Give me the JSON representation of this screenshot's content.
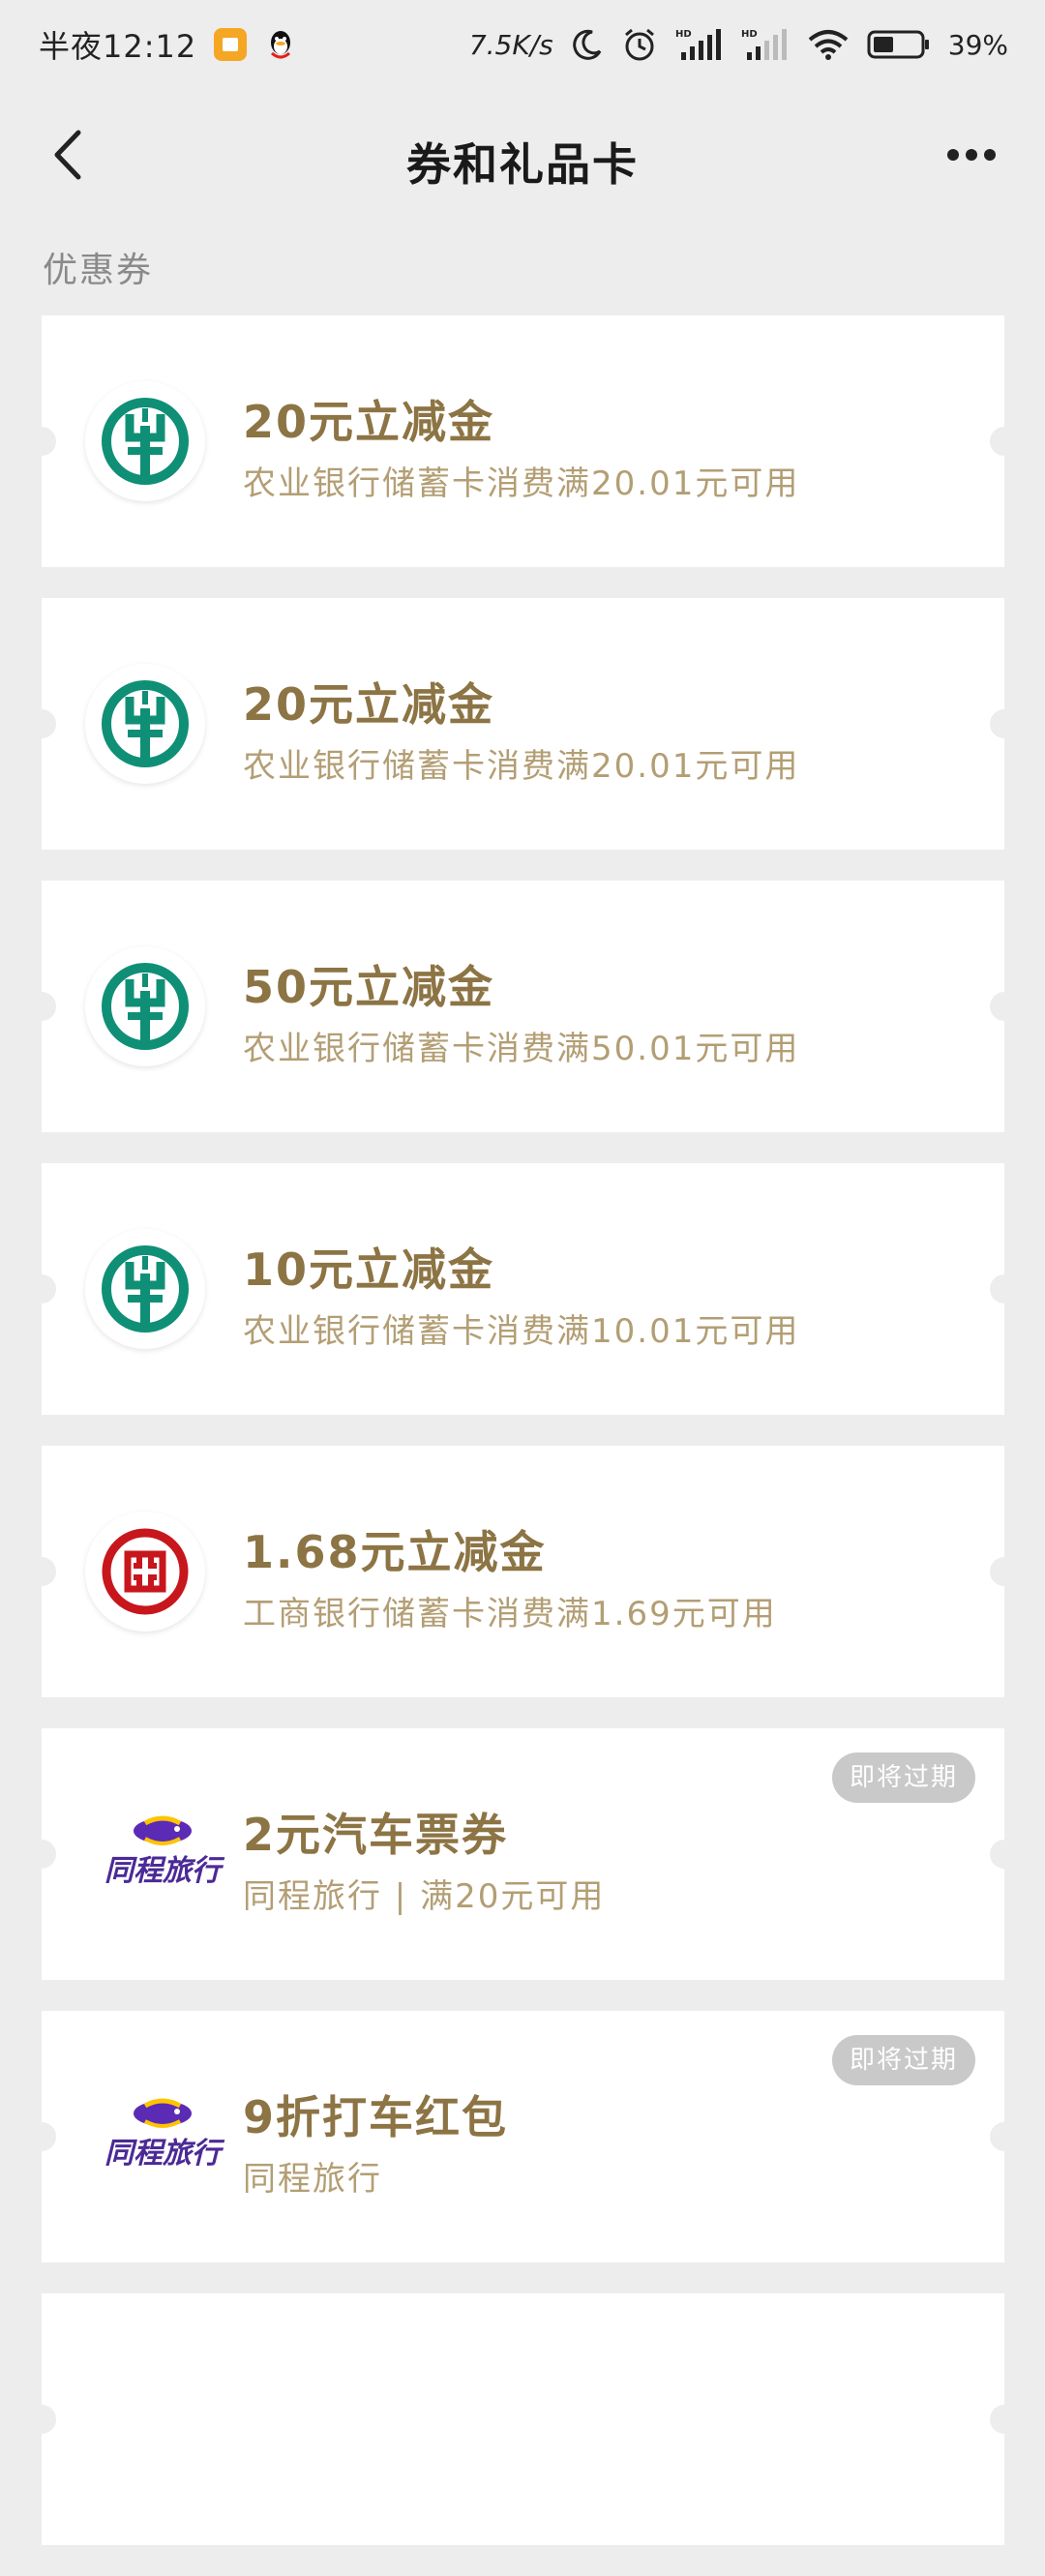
{
  "status_bar": {
    "time": "半夜12:12",
    "network_speed": "7.5K/s",
    "battery": "39%",
    "icons": [
      "files-app-icon",
      "qq-icon",
      "moon-icon",
      "alarm-icon",
      "hd-signal-icon",
      "hd-signal-icon",
      "wifi-icon",
      "battery-icon"
    ]
  },
  "header": {
    "title": "券和礼品卡",
    "back_icon": "chevron-left-icon",
    "more_icon": "more-dots-icon"
  },
  "section": {
    "label": "优惠券"
  },
  "coupons": [
    {
      "title": "20元立减金",
      "desc": "农业银行储蓄卡消费满20.01元可用",
      "logo": "abc-bank-logo",
      "badge": ""
    },
    {
      "title": "20元立减金",
      "desc": "农业银行储蓄卡消费满20.01元可用",
      "logo": "abc-bank-logo",
      "badge": ""
    },
    {
      "title": "50元立减金",
      "desc": "农业银行储蓄卡消费满50.01元可用",
      "logo": "abc-bank-logo",
      "badge": ""
    },
    {
      "title": "10元立减金",
      "desc": "农业银行储蓄卡消费满10.01元可用",
      "logo": "abc-bank-logo",
      "badge": ""
    },
    {
      "title": "1.68元立减金",
      "desc": "工商银行储蓄卡消费满1.69元可用",
      "logo": "icbc-bank-logo",
      "badge": ""
    },
    {
      "title": "2元汽车票券",
      "desc": "同程旅行 | 满20元可用",
      "logo": "tongcheng-travel-logo",
      "logo_text": "同程旅行",
      "badge": "即将过期"
    },
    {
      "title": "9折打车红包",
      "desc": "同程旅行",
      "logo": "tongcheng-travel-logo",
      "logo_text": "同程旅行",
      "badge": "即将过期"
    }
  ],
  "colors": {
    "background": "#ededed",
    "card": "#ffffff",
    "title_gold": "#8c7444",
    "desc_gold": "#b39e74",
    "abc_green": "#0f8f76",
    "icbc_red": "#c8161d",
    "tongcheng_purple": "#4b2a96",
    "badge_grey": "#c9c9c9"
  }
}
